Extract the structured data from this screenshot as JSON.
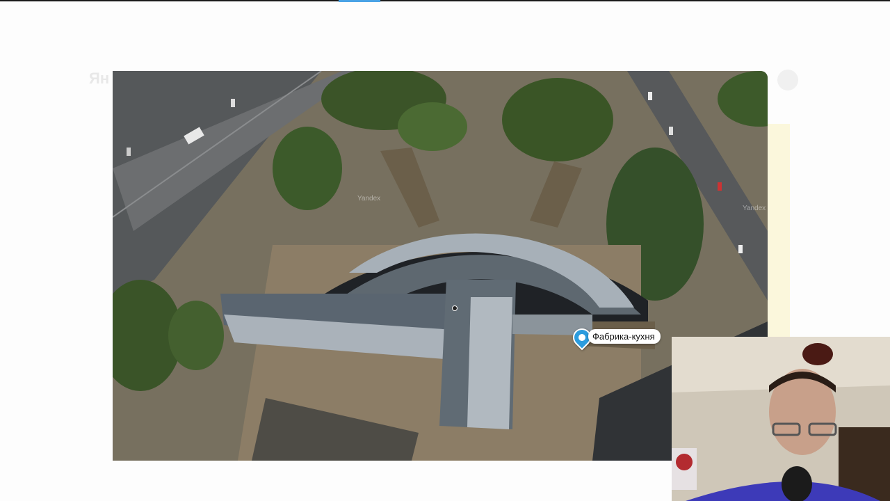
{
  "map": {
    "marker_label": "Фабрика-кухня",
    "watermark": "Yandex"
  },
  "colors": {
    "marker": "#2c9cde",
    "roof_metal": "#a9b3bb",
    "roof_dark": "#5f6a72",
    "trees": "#3f5a2c"
  },
  "icons": [
    "map-marker-icon",
    "cursor-icon"
  ]
}
